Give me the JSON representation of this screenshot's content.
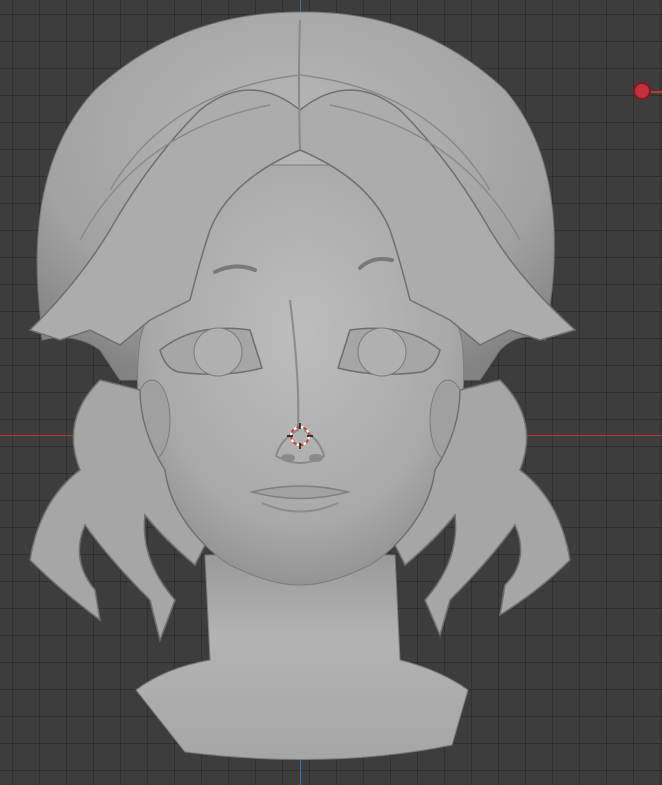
{
  "viewport": {
    "mode": "sculpt",
    "view": "front-orthographic",
    "background_color": "#3d3d3d",
    "grid": true
  },
  "axes": {
    "x_axis_color": "#b5383f",
    "y_axis_color": "#3f6fb0"
  },
  "scene_objects": {
    "model": "head-sculpt-icon",
    "light": "light-gizmo-icon",
    "cursor": "3d-cursor-icon"
  }
}
